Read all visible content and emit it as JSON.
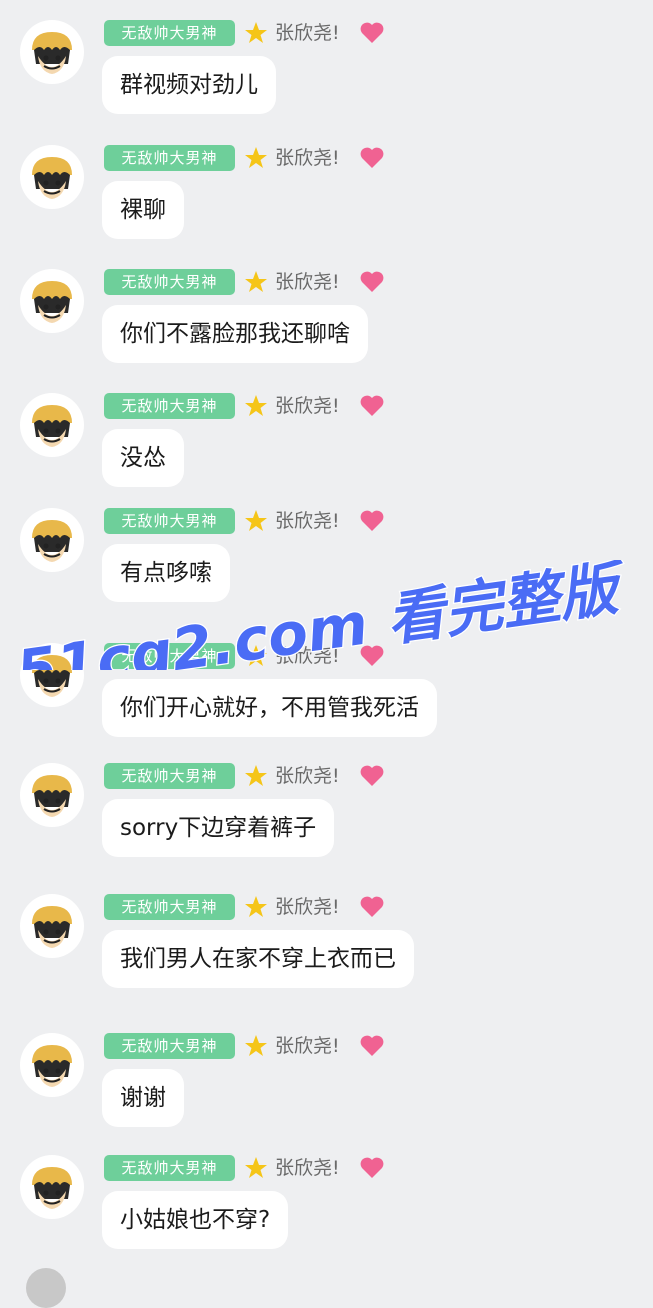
{
  "chat": {
    "messages": [
      {
        "tag": "无敌帅大男神",
        "sender": "张欣尧!",
        "text": "群视频对劲儿"
      },
      {
        "tag": "无敌帅大男神",
        "sender": "张欣尧!",
        "text": "裸聊"
      },
      {
        "tag": "无敌帅大男神",
        "sender": "张欣尧!",
        "text": "你们不露脸那我还聊啥"
      },
      {
        "tag": "无敌帅大男神",
        "sender": "张欣尧!",
        "text": "没怂"
      },
      {
        "tag": "无敌帅大男神",
        "sender": "张欣尧!",
        "text": "有点哆嗦"
      },
      {
        "tag": "无敌帅大男神",
        "sender": "张欣尧!",
        "text": "你们开心就好，不用管我死活"
      },
      {
        "tag": "无敌帅大男神",
        "sender": "张欣尧!",
        "text": "sorry下边穿着裤子"
      },
      {
        "tag": "无敌帅大男神",
        "sender": "张欣尧!",
        "text": "我们男人在家不穿上衣而已"
      },
      {
        "tag": "无敌帅大男神",
        "sender": "张欣尧!",
        "text": "谢谢"
      },
      {
        "tag": "无敌帅大男神",
        "sender": "张欣尧!",
        "text": "小姑娘也不穿?"
      }
    ]
  },
  "watermark": {
    "text": "51cg2.com 看完整版"
  },
  "icons": {
    "avatar": "cartoon-avatar",
    "star": "star-icon",
    "heart": "heart-icon"
  },
  "colors": {
    "tag_bg": "#6ecf9a",
    "star": "#f5c518",
    "heart": "#f06292",
    "watermark": "#4a6cf5",
    "background": "#eeeff1"
  }
}
